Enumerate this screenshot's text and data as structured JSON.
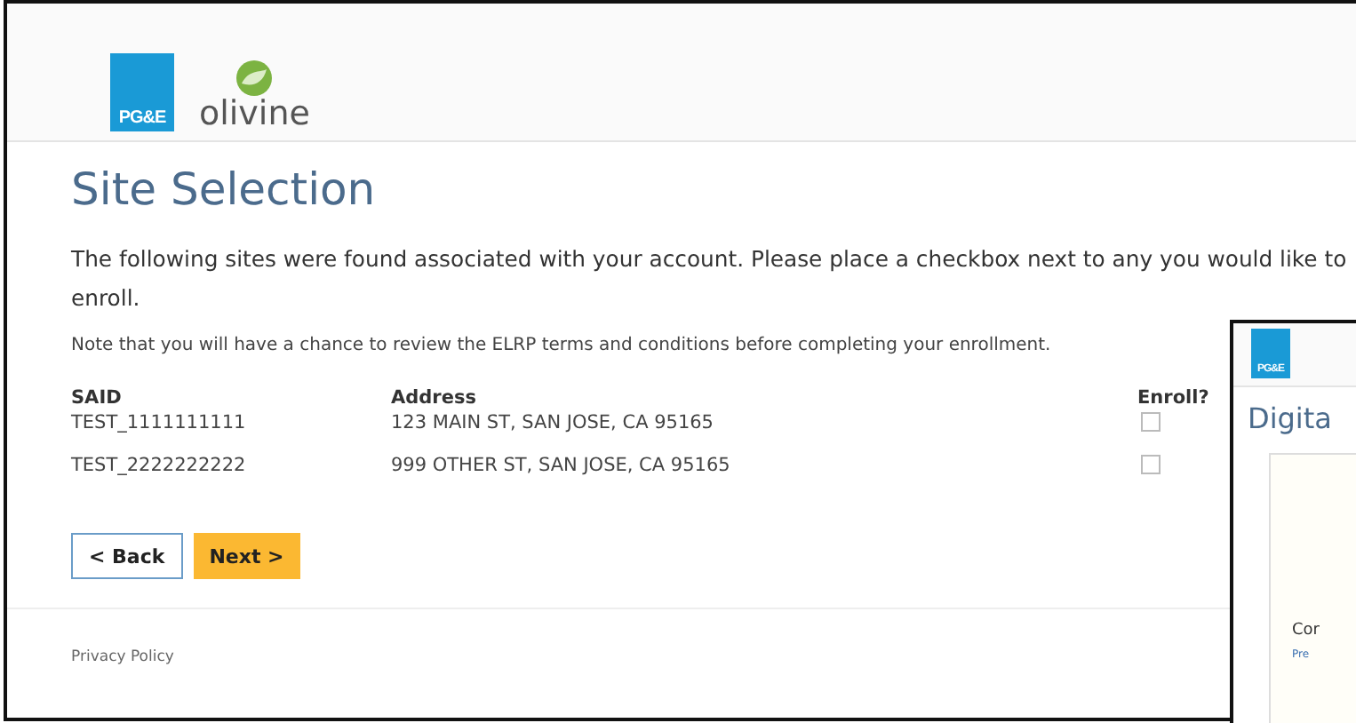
{
  "main_window": {
    "logos": {
      "pge": "PG&E",
      "olivine": "olivine"
    },
    "title": "Site Selection",
    "intro": "The following sites were found associated with your account. Please place a checkbox next to any you would like to enroll.",
    "note": "Note that you will have a chance to review the ELRP terms and conditions before completing your enrollment.",
    "table": {
      "columns": [
        "SAID",
        "Address",
        "Enroll?"
      ],
      "rows": [
        {
          "said": "TEST_1111111111",
          "address": "123 MAIN ST, SAN JOSE, CA 95165",
          "checked": false
        },
        {
          "said": "TEST_2222222222",
          "address": "999 OTHER ST, SAN JOSE, CA 95165",
          "checked": false
        }
      ]
    },
    "buttons": {
      "back": "< Back",
      "next": "Next >"
    },
    "footer": {
      "link": "Privacy Policy"
    }
  },
  "second_window": {
    "logo": "PG&E",
    "title": "Digita",
    "text": "Cor",
    "link": "Pre"
  }
}
